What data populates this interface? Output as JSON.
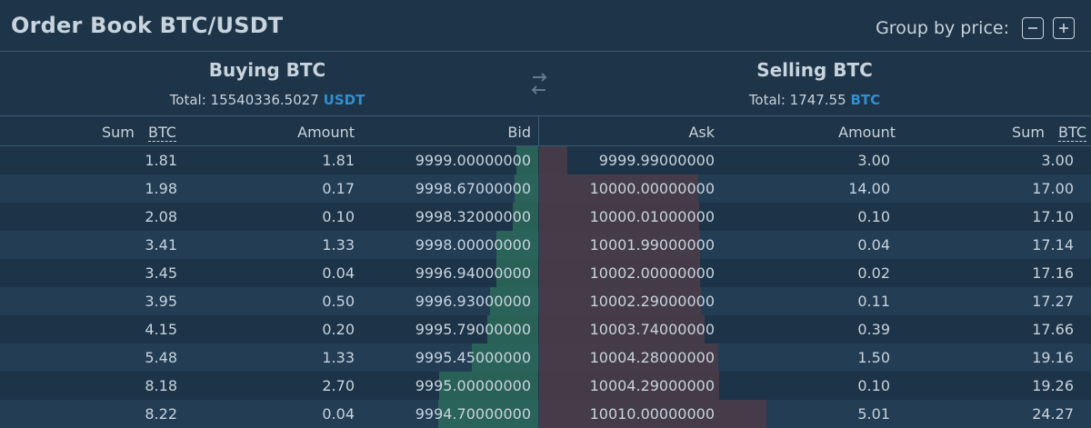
{
  "title": "Order Book BTC/USDT",
  "group_by": {
    "label": "Group by price:",
    "minus_icon": "minus-icon",
    "plus_icon": "plus-icon"
  },
  "buying": {
    "title": "Buying BTC",
    "total_label": "Total: 15540336.5027",
    "total_currency": "USDT"
  },
  "selling": {
    "title": "Selling BTC",
    "total_label": "Total: 1747.55",
    "total_currency": "BTC"
  },
  "columns": {
    "sum": "Sum",
    "sum_unit": "BTC",
    "amount": "Amount",
    "bid": "Bid",
    "ask": "Ask",
    "amount2": "Amount",
    "sum2": "Sum",
    "sum2_unit": "BTC"
  },
  "colors": {
    "bid_depth": "#2b6a5a",
    "ask_depth": "#4a3c48",
    "accent": "#2f8fd1"
  },
  "bids": [
    {
      "sum": "1.81",
      "amount": "1.81",
      "price": "9999.00000000"
    },
    {
      "sum": "1.98",
      "amount": "0.17",
      "price": "9998.67000000"
    },
    {
      "sum": "2.08",
      "amount": "0.10",
      "price": "9998.32000000"
    },
    {
      "sum": "3.41",
      "amount": "1.33",
      "price": "9998.00000000"
    },
    {
      "sum": "3.45",
      "amount": "0.04",
      "price": "9996.94000000"
    },
    {
      "sum": "3.95",
      "amount": "0.50",
      "price": "9996.93000000"
    },
    {
      "sum": "4.15",
      "amount": "0.20",
      "price": "9995.79000000"
    },
    {
      "sum": "5.48",
      "amount": "1.33",
      "price": "9995.45000000"
    },
    {
      "sum": "8.18",
      "amount": "2.70",
      "price": "9995.00000000"
    },
    {
      "sum": "8.22",
      "amount": "0.04",
      "price": "9994.70000000"
    }
  ],
  "asks": [
    {
      "price": "9999.99000000",
      "amount": "3.00",
      "sum": "3.00"
    },
    {
      "price": "10000.00000000",
      "amount": "14.00",
      "sum": "17.00"
    },
    {
      "price": "10000.01000000",
      "amount": "0.10",
      "sum": "17.10"
    },
    {
      "price": "10001.99000000",
      "amount": "0.04",
      "sum": "17.14"
    },
    {
      "price": "10002.00000000",
      "amount": "0.02",
      "sum": "17.16"
    },
    {
      "price": "10002.29000000",
      "amount": "0.11",
      "sum": "17.27"
    },
    {
      "price": "10003.74000000",
      "amount": "0.39",
      "sum": "17.66"
    },
    {
      "price": "10004.28000000",
      "amount": "1.50",
      "sum": "19.16"
    },
    {
      "price": "10004.29000000",
      "amount": "0.10",
      "sum": "19.26"
    },
    {
      "price": "10010.00000000",
      "amount": "5.01",
      "sum": "24.27"
    }
  ]
}
